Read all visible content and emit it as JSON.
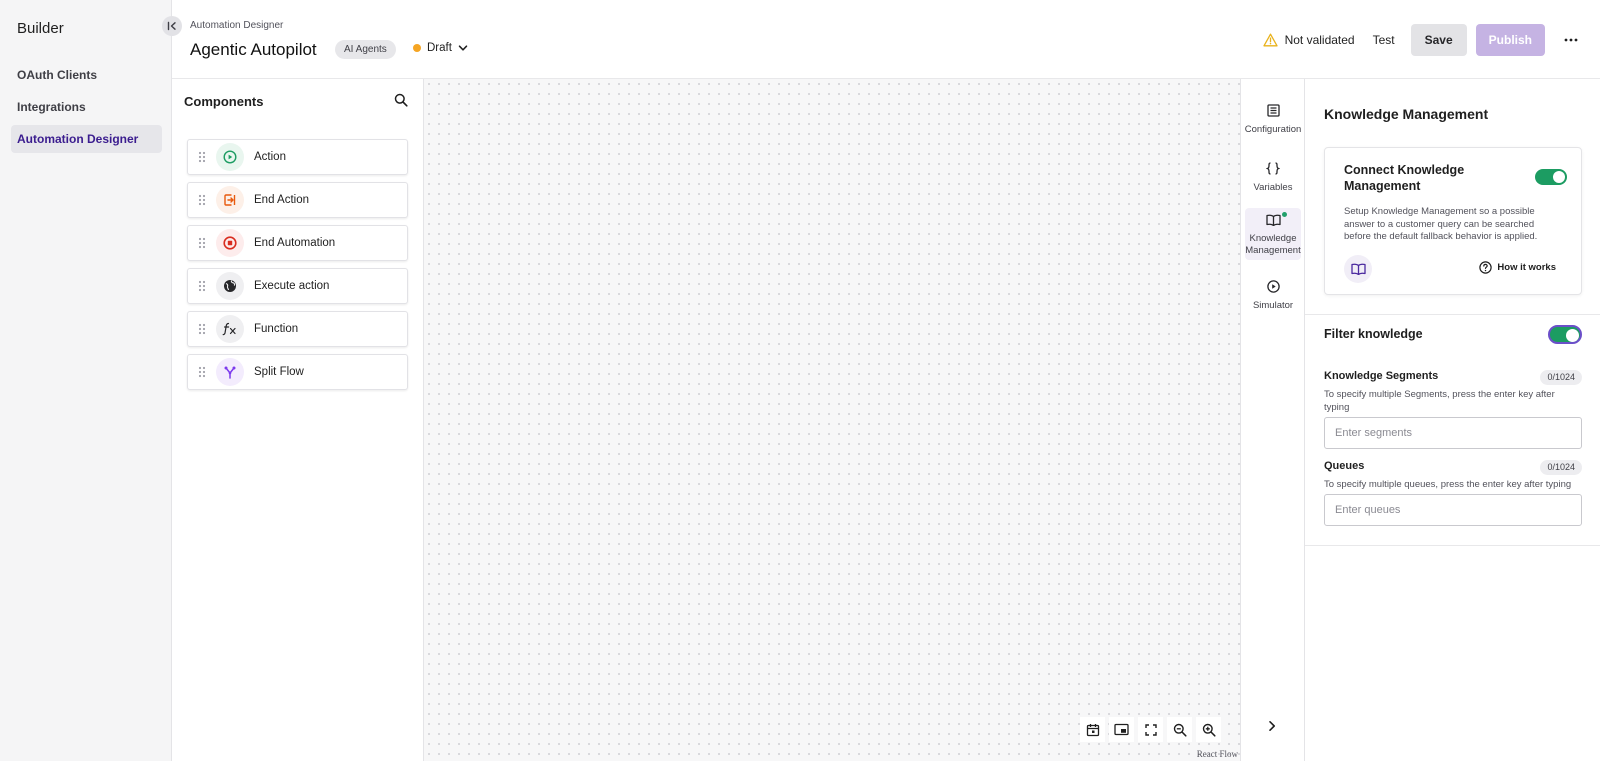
{
  "sidebar": {
    "brand": "Builder",
    "items": [
      {
        "label": "OAuth Clients",
        "active": false
      },
      {
        "label": "Integrations",
        "active": false
      },
      {
        "label": "Automation Designer",
        "active": true
      }
    ]
  },
  "header": {
    "breadcrumb": "Automation Designer",
    "title": "Agentic Autopilot",
    "tag": "AI Agents",
    "status": "Draft",
    "validation": "Not validated",
    "test_label": "Test",
    "save_label": "Save",
    "publish_label": "Publish"
  },
  "components": {
    "title": "Components",
    "items": [
      {
        "label": "Action",
        "icon": "play-circle-icon",
        "color": "#1c9c62",
        "bg": "#e9f6ef"
      },
      {
        "label": "End Action",
        "icon": "exit-icon",
        "color": "#e8590c",
        "bg": "#fdf0e8"
      },
      {
        "label": "End Automation",
        "icon": "stop-circle-icon",
        "color": "#d92d20",
        "bg": "#fdecec"
      },
      {
        "label": "Execute action",
        "icon": "globe-icon",
        "color": "#27272a",
        "bg": "#efeff1"
      },
      {
        "label": "Function",
        "icon": "function-icon",
        "color": "#27272a",
        "bg": "#efeff1"
      },
      {
        "label": "Split Flow",
        "icon": "split-icon",
        "color": "#7c3aed",
        "bg": "#f3ecfd"
      }
    ]
  },
  "canvas": {
    "attribution": "React Flow"
  },
  "rail": {
    "items": [
      {
        "label": "Configuration",
        "icon": "list-icon"
      },
      {
        "label": "Variables",
        "icon": "braces-icon"
      },
      {
        "label": "Knowledge Management",
        "icon": "book-icon",
        "active": true
      },
      {
        "label": "Simulator",
        "icon": "play-icon"
      }
    ]
  },
  "panel": {
    "title": "Knowledge Management",
    "card": {
      "title": "Connect Knowledge Management",
      "enabled": true,
      "description": "Setup Knowledge Management so a possible answer to a customer query can be searched before the default fallback behavior is applied.",
      "how_label": "How it works"
    },
    "filter": {
      "title": "Filter knowledge",
      "enabled": true,
      "segments": {
        "label": "Knowledge Segments",
        "counter": "0/1024",
        "help": "To specify multiple Segments, press the enter key after typing",
        "placeholder": "Enter segments",
        "value": ""
      },
      "queues": {
        "label": "Queues",
        "counter": "0/1024",
        "help": "To specify multiple queues, press the enter key after typing",
        "placeholder": "Enter queues",
        "value": ""
      }
    }
  },
  "colors": {
    "accent": "#3b1d8f",
    "toggle_on": "#1c9c62",
    "draft_dot": "#f5a524",
    "warning": "#e9b21b",
    "publish_disabled": "#c5b3e3"
  }
}
